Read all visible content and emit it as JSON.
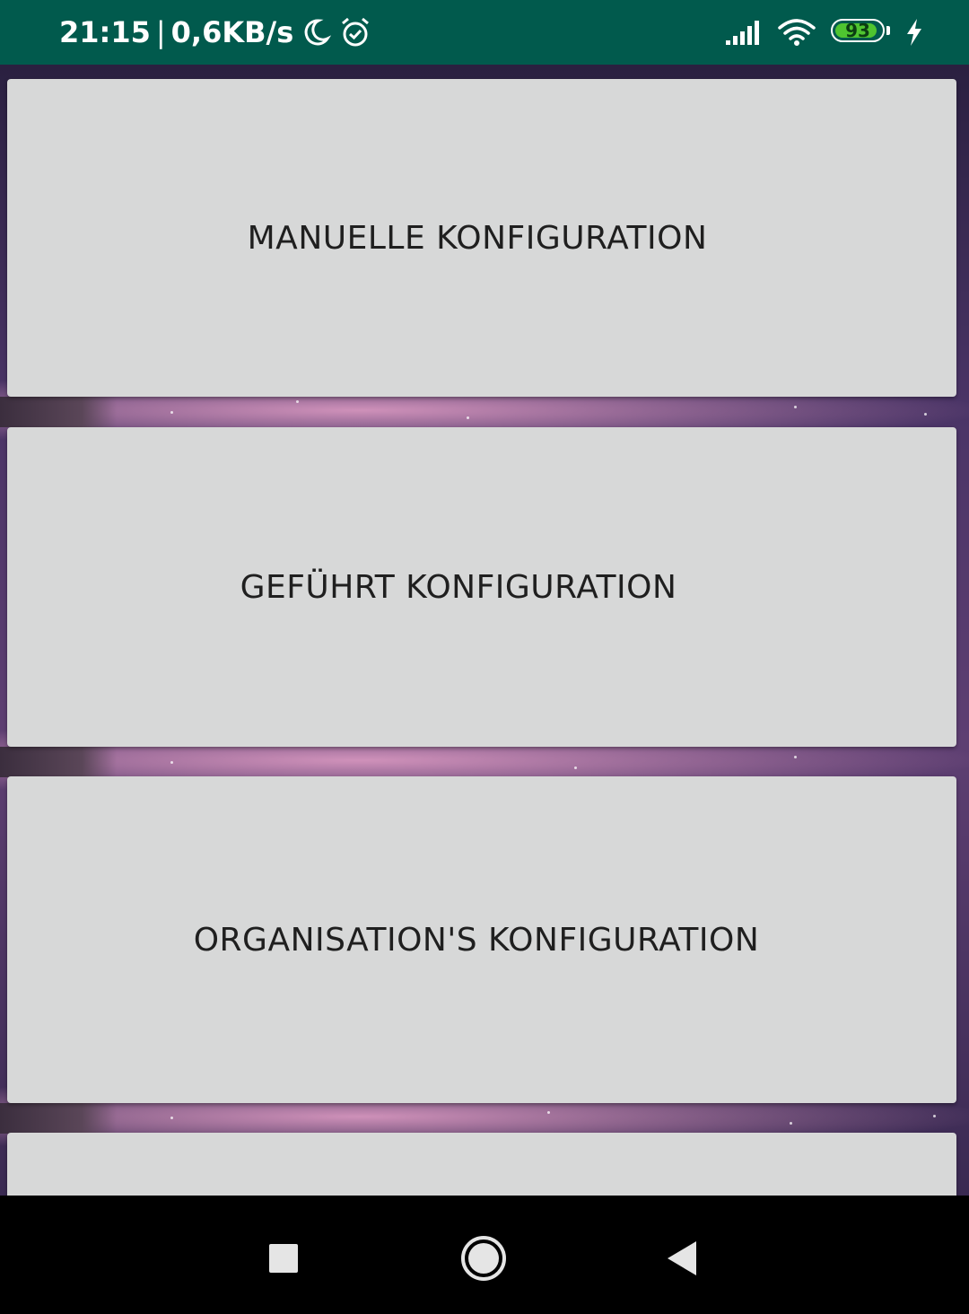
{
  "status_bar": {
    "time": "21:15",
    "separator": "|",
    "network_speed": "0,6KB/s",
    "battery_level": "93",
    "battery_fraction": 0.93,
    "icons": [
      "moon-icon",
      "alarm-icon",
      "signal-icon",
      "wifi-icon",
      "battery-icon",
      "charging-bolt-icon"
    ],
    "colors": {
      "background": "#015a4d",
      "battery_fill": "#4fc430"
    }
  },
  "main": {
    "cards": [
      {
        "label": "MANUELLE KONFIGURATION"
      },
      {
        "label": "GEFÜHRT KONFIGURATION"
      },
      {
        "label": "ORGANISATION'S KONFIGURATION"
      },
      {
        "label": ""
      }
    ],
    "colors": {
      "card_background": "#d7d8d8",
      "card_text": "#1f1f1f"
    }
  },
  "nav_bar": {
    "buttons": [
      "recent-apps-icon",
      "home-icon",
      "back-icon"
    ]
  }
}
